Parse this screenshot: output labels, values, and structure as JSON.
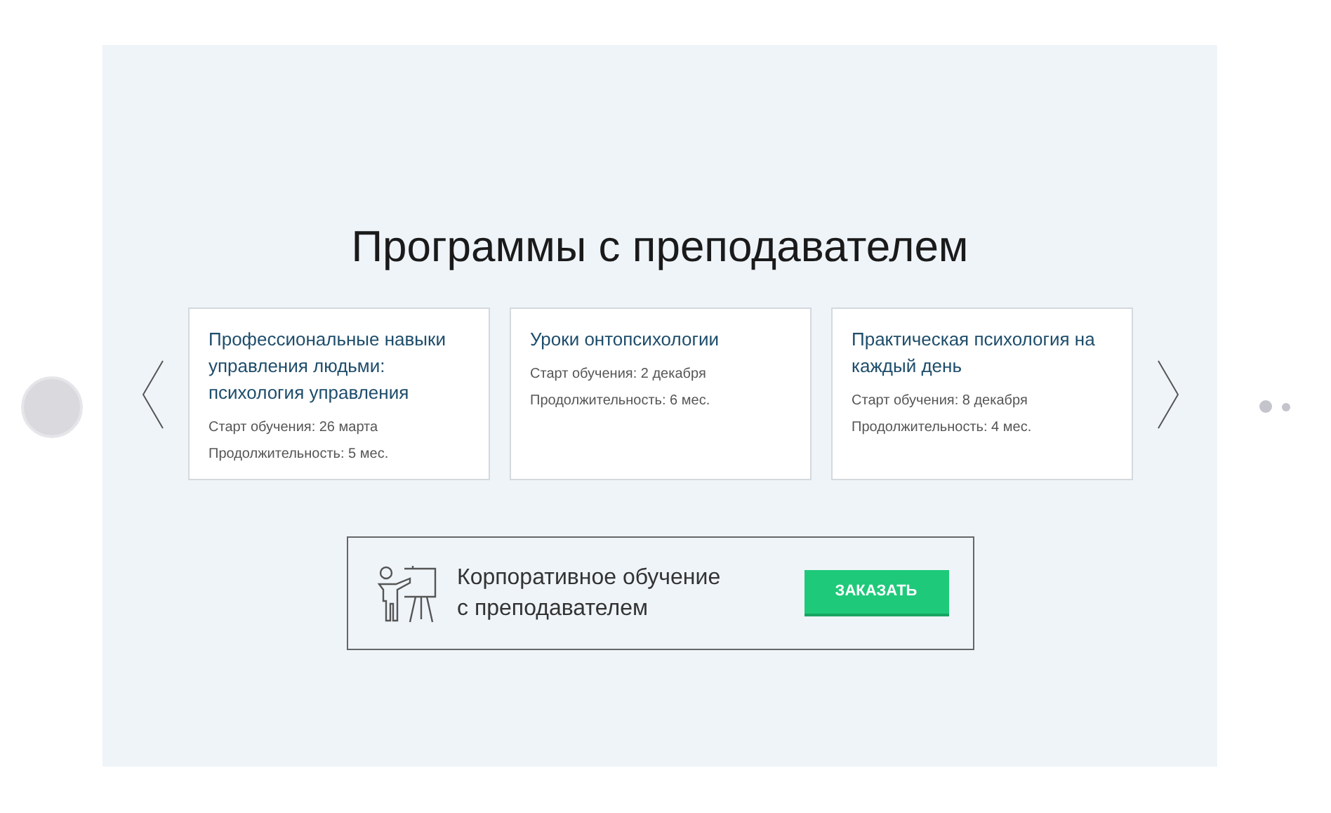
{
  "title": "Программы с преподавателем",
  "courses": [
    {
      "title": "Профессиональные навыки управления людьми: психология управления",
      "start": "Старт обучения: 26 марта",
      "duration": "Продолжительность: 5 мес."
    },
    {
      "title": "Уроки онтопсихологии",
      "start": "Старт обучения: 2 декабря",
      "duration": "Продолжительность: 6 мес."
    },
    {
      "title": "Практическая психология на каждый день",
      "start": "Старт обучения: 8 декабря",
      "duration": "Продолжительность: 4 мес."
    }
  ],
  "banner": {
    "text_lines": [
      "Корпоративное обучение",
      "с преподавателем"
    ],
    "button": "ЗАКАЗАТЬ"
  },
  "dots": [
    {
      "selected": true
    },
    {
      "selected": false
    }
  ]
}
